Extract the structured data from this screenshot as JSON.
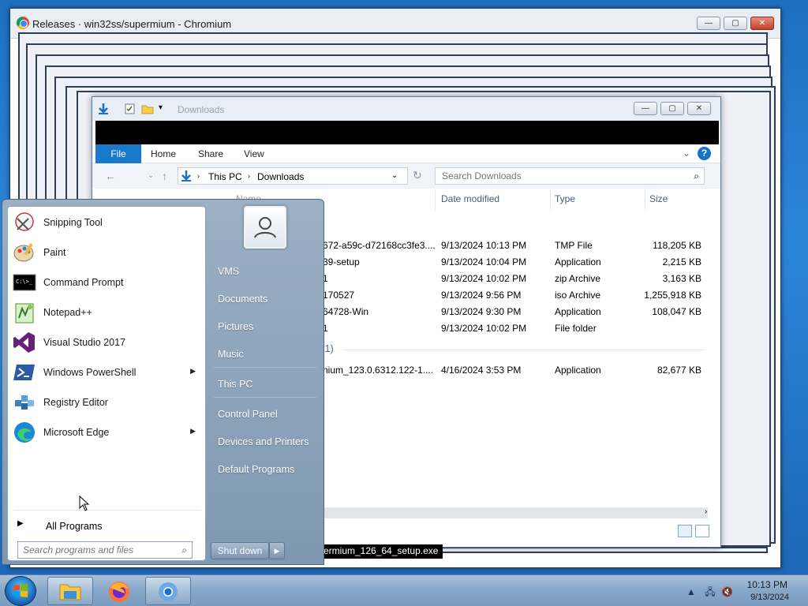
{
  "chromium": {
    "title": "Releases · win32ss/supermium - Chromium",
    "min": "—",
    "max": "▢",
    "close": "✕"
  },
  "explorer": {
    "title": "Downloads",
    "ribbon_tabs": [
      "File",
      "Home",
      "Share",
      "View"
    ],
    "breadcrumb": [
      "This PC",
      "Downloads"
    ],
    "search_placeholder": "Search Downloads",
    "columns": {
      "name": "Name",
      "date": "Date modified",
      "type": "Type",
      "size": "Size"
    },
    "files": [
      {
        "name": "672-a59c-d72168cc3fe3....",
        "date": "9/13/2024 10:13 PM",
        "type": "TMP File",
        "size": "118,205 KB"
      },
      {
        "name": "39-setup",
        "date": "9/13/2024 10:04 PM",
        "type": "Application",
        "size": "2,215 KB"
      },
      {
        "name": "1",
        "date": "9/13/2024 10:02 PM",
        "type": "zip Archive",
        "size": "3,163 KB"
      },
      {
        "name": "170527",
        "date": "9/13/2024 9:56 PM",
        "type": "iso Archive",
        "size": "1,255,918 KB"
      },
      {
        "name": "64728-Win",
        "date": "9/13/2024 9:30 PM",
        "type": "Application",
        "size": "108,047 KB"
      },
      {
        "name": "1",
        "date": "9/13/2024 10:02 PM",
        "type": "File folder",
        "size": ""
      }
    ],
    "group_label": "(1)",
    "older_files": [
      {
        "name": "nium_123.0.6312.122-1....",
        "date": "4/16/2024 3:53 PM",
        "type": "Application",
        "size": "82,677 KB"
      }
    ],
    "tooltip": "ermium_126_64_setup.exe"
  },
  "start_menu": {
    "programs": [
      {
        "label": "Snipping Tool",
        "icon": "scissors-icon",
        "arrow": false
      },
      {
        "label": "Paint",
        "icon": "paint-palette-icon",
        "arrow": false
      },
      {
        "label": "Command Prompt",
        "icon": "command-prompt-icon",
        "arrow": false
      },
      {
        "label": "Notepad++",
        "icon": "notepad-plus-plus-icon",
        "arrow": false
      },
      {
        "label": "Visual Studio 2017",
        "icon": "visual-studio-icon",
        "arrow": false
      },
      {
        "label": "Windows PowerShell",
        "icon": "powershell-icon",
        "arrow": true
      },
      {
        "label": "Registry Editor",
        "icon": "registry-editor-icon",
        "arrow": false
      },
      {
        "label": "Microsoft Edge",
        "icon": "edge-icon",
        "arrow": true
      }
    ],
    "all_programs": "All Programs",
    "search_placeholder": "Search programs and files",
    "right_items": [
      "VMS",
      "Documents",
      "Pictures",
      "Music",
      "This PC",
      "Control Panel",
      "Devices and Printers",
      "Default Programs"
    ],
    "shutdown": "Shut down"
  },
  "taskbar": {
    "time": "10:13 PM",
    "date": "9/13/2024",
    "pinned": [
      "file-explorer-icon",
      "firefox-icon",
      "chromium-icon"
    ]
  }
}
